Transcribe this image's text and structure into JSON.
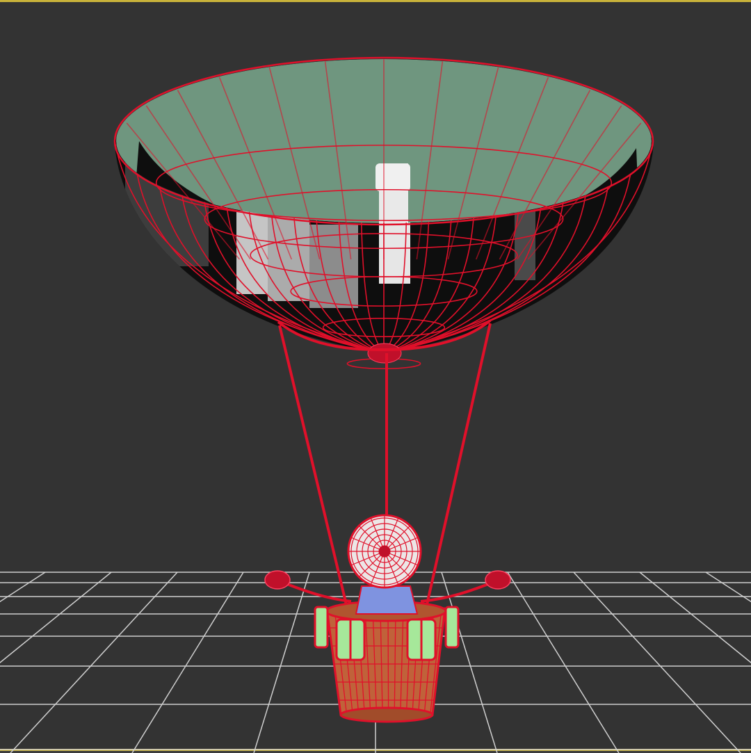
{
  "viewport": {
    "name": "perspective-viewport",
    "background": "#333333",
    "active_border_color": "#c8b23a"
  },
  "colors": {
    "wireframe": "#e0102a",
    "balloon_panel": "#7aa58e",
    "balloon_panel_dark": "#5b8069",
    "balloon_inner_dark": "#101010",
    "basket": "#c0623a",
    "window_fill": "#a6e89a",
    "neck": "#7f93e0",
    "head": "#e8e0e0",
    "grid_line": "#d8d8d8"
  },
  "model": {
    "object": "hot-air-balloon",
    "parts": [
      "balloon-envelope",
      "ropes",
      "head-sphere",
      "neck-cylinder",
      "basket",
      "basket-windows",
      "side-arms"
    ]
  }
}
